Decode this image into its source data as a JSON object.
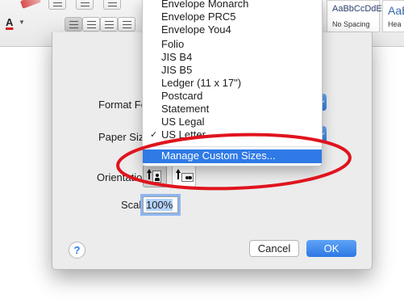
{
  "toolbar": {
    "style_cards": [
      {
        "sample": "AaBbCcDdEe",
        "name": "No Spacing"
      },
      {
        "sample": "AaBb",
        "name": "Hea"
      }
    ],
    "icons": [
      "pencil-icon",
      "bullet-list-icon",
      "numbered-list-icon",
      "multilevel-list-icon",
      "font-color-icon",
      "align-left-icon",
      "align-center-icon",
      "align-right-icon",
      "justify-icon"
    ]
  },
  "font_color": {
    "letter": "A",
    "accent": "#d21a1a"
  },
  "dialog": {
    "format_for_label": "Format For:",
    "paper_size_label": "Paper Size:",
    "orientation_label": "Orientation:",
    "scale_label": "Scale:",
    "scale_value": "100%",
    "help_label": "?",
    "cancel_label": "Cancel",
    "ok_label": "OK",
    "accent": "#2f7ae6"
  },
  "paper_menu": {
    "items": [
      "Envelope Monarch",
      "Envelope PRC5",
      "Envelope You4",
      "Folio",
      "JIS B4",
      "JIS B5",
      "Ledger (11 x 17\")",
      "Postcard",
      "Statement",
      "US Legal",
      "US Letter"
    ],
    "check_mark": "✓",
    "selected_item": "US Letter",
    "manage_label": "Manage Custom Sizes...",
    "highlight_color": "#2f7ae6"
  },
  "annotation": {
    "shape": "ellipse",
    "color": "#e0141e"
  }
}
